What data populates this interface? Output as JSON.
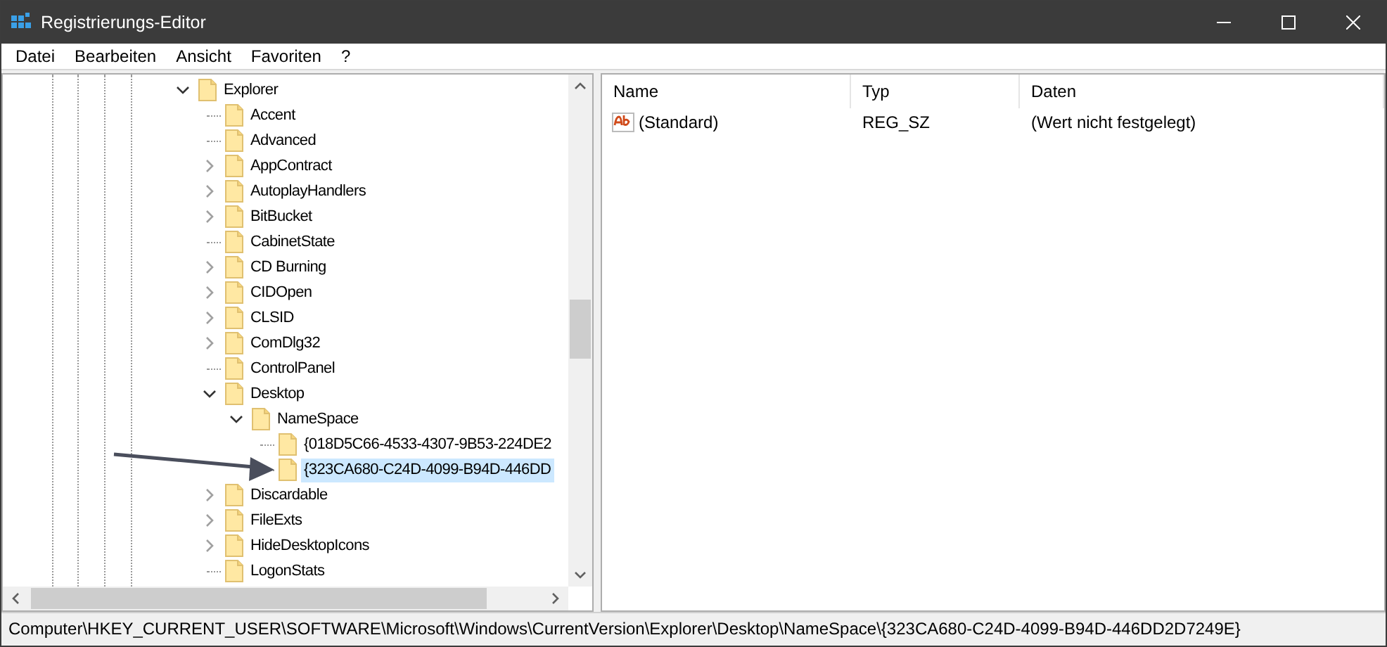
{
  "window": {
    "title": "Registrierungs-Editor"
  },
  "menu": [
    "Datei",
    "Bearbeiten",
    "Ansicht",
    "Favoriten",
    "?"
  ],
  "tree": [
    {
      "label": "Explorer",
      "kind": "branch",
      "expanded": true,
      "selected": false,
      "children": [
        {
          "label": "Accent",
          "kind": "leaf",
          "selected": false
        },
        {
          "label": "Advanced",
          "kind": "leaf",
          "selected": false
        },
        {
          "label": "AppContract",
          "kind": "branch",
          "expanded": false,
          "selected": false
        },
        {
          "label": "AutoplayHandlers",
          "kind": "branch",
          "expanded": false,
          "selected": false
        },
        {
          "label": "BitBucket",
          "kind": "branch",
          "expanded": false,
          "selected": false
        },
        {
          "label": "CabinetState",
          "kind": "leaf",
          "selected": false
        },
        {
          "label": "CD Burning",
          "kind": "branch",
          "expanded": false,
          "selected": false
        },
        {
          "label": "CIDOpen",
          "kind": "branch",
          "expanded": false,
          "selected": false
        },
        {
          "label": "CLSID",
          "kind": "branch",
          "expanded": false,
          "selected": false
        },
        {
          "label": "ComDlg32",
          "kind": "branch",
          "expanded": false,
          "selected": false
        },
        {
          "label": "ControlPanel",
          "kind": "leaf",
          "selected": false
        },
        {
          "label": "Desktop",
          "kind": "branch",
          "expanded": true,
          "selected": false,
          "children": [
            {
              "label": "NameSpace",
              "kind": "branch",
              "expanded": true,
              "selected": false,
              "children": [
                {
                  "label": "{018D5C66-4533-4307-9B53-224DE2",
                  "kind": "leaf",
                  "selected": false
                },
                {
                  "label": "{323CA680-C24D-4099-B94D-446DD",
                  "kind": "leaf",
                  "selected": true
                }
              ]
            }
          ]
        },
        {
          "label": "Discardable",
          "kind": "branch",
          "expanded": false,
          "selected": false
        },
        {
          "label": "FileExts",
          "kind": "branch",
          "expanded": false,
          "selected": false
        },
        {
          "label": "HideDesktopIcons",
          "kind": "branch",
          "expanded": false,
          "selected": false
        },
        {
          "label": "LogonStats",
          "kind": "leaf",
          "selected": false
        }
      ]
    }
  ],
  "values": {
    "columns": [
      "Name",
      "Typ",
      "Daten"
    ],
    "rows": [
      {
        "name": "(Standard)",
        "type": "REG_SZ",
        "data": "(Wert nicht festgelegt)"
      }
    ]
  },
  "status_bar": "Computer\\HKEY_CURRENT_USER\\SOFTWARE\\Microsoft\\Windows\\CurrentVersion\\Explorer\\Desktop\\NameSpace\\{323CA680-C24D-4099-B94D-446DD2D7249E}"
}
